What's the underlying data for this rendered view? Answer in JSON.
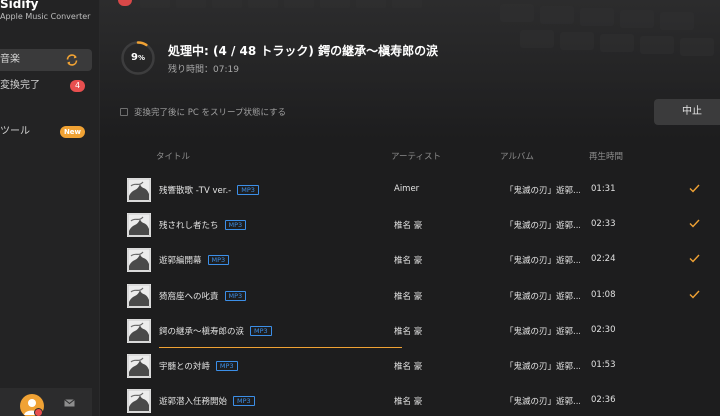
{
  "app": {
    "name": "Sidify",
    "subtitle": "Apple Music Converter"
  },
  "sidebar": {
    "items": [
      {
        "label": "音楽"
      },
      {
        "label": "変換完了",
        "badge": "4"
      },
      {
        "label": "ツール",
        "badge": "New"
      }
    ]
  },
  "processing": {
    "percent": "9",
    "percent_unit": "%",
    "percent_value": 9,
    "title": "処理中: (4 / 48 トラック) 鍔の継承～槇寿郎の涙",
    "remaining": "残り時間：07:19",
    "sleep_option": "変換完了後に PC をスリープ状態にする",
    "stop_label": "中止"
  },
  "columns": {
    "title": "タイトル",
    "artist": "アーティスト",
    "album": "アルバム",
    "duration": "再生時間"
  },
  "tracks": [
    {
      "title": "残響散歌 -TV ver.-",
      "format": "MP3",
      "artist": "Aimer",
      "album": "「鬼滅の刃」遊郭...",
      "duration": "01:31",
      "done": true,
      "progress": 1
    },
    {
      "title": "残されし者たち",
      "format": "MP3",
      "artist": "椎名 豪",
      "album": "「鬼滅の刃」遊郭...",
      "duration": "02:33",
      "done": true,
      "progress": 1
    },
    {
      "title": "遊郭編開幕",
      "format": "MP3",
      "artist": "椎名 豪",
      "album": "「鬼滅の刃」遊郭...",
      "duration": "02:24",
      "done": true,
      "progress": 1
    },
    {
      "title": "猗窩座への叱責",
      "format": "MP3",
      "artist": "椎名 豪",
      "album": "「鬼滅の刃」遊郭...",
      "duration": "01:08",
      "done": true,
      "progress": 1
    },
    {
      "title": "鍔の継承～槇寿郎の涙",
      "format": "MP3",
      "artist": "椎名 豪",
      "album": "「鬼滅の刃」遊郭...",
      "duration": "02:30",
      "done": false,
      "progress": 0.45
    },
    {
      "title": "宇髄との対峙",
      "format": "MP3",
      "artist": "椎名 豪",
      "album": "「鬼滅の刃」遊郭...",
      "duration": "01:53",
      "done": false,
      "progress": 0
    },
    {
      "title": "遊郭潜入任務開始",
      "format": "MP3",
      "artist": "椎名 豪",
      "album": "「鬼滅の刃」遊郭...",
      "duration": "02:36",
      "done": false,
      "progress": 0
    }
  ],
  "colors": {
    "accent": "#f0a234",
    "tag": "#3c8fe8",
    "badge": "#e84f4f"
  },
  "icons": [
    "sync-icon",
    "mail-icon",
    "check-icon",
    "avatar-icon"
  ]
}
